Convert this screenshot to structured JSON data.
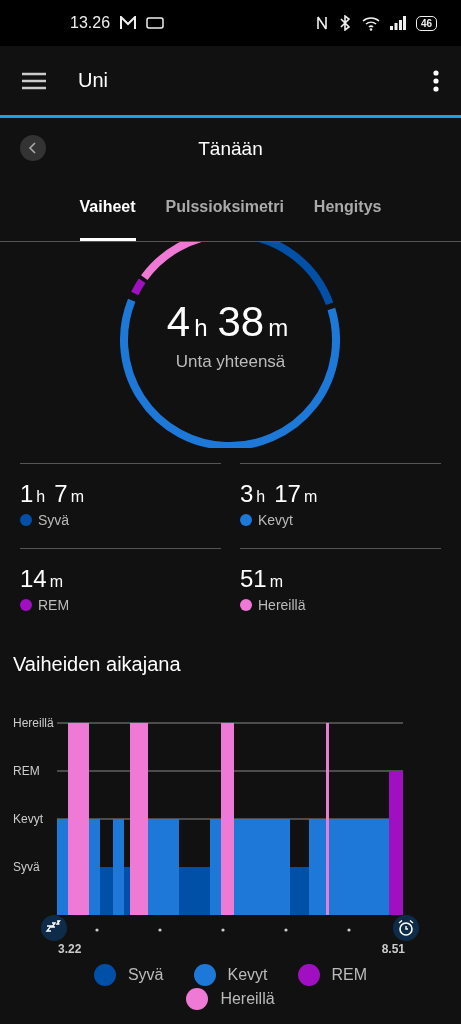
{
  "status_bar": {
    "time": "13.26",
    "battery": "46"
  },
  "app_bar": {
    "title": "Uni"
  },
  "date_nav": {
    "title": "Tänään"
  },
  "tabs": [
    {
      "label": "Vaiheet",
      "selected": true
    },
    {
      "label": "Pulssioksimetri",
      "selected": false
    },
    {
      "label": "Hengitys",
      "selected": false
    }
  ],
  "total": {
    "hours": "4",
    "hours_unit": "h",
    "minutes": "38",
    "minutes_unit": "m",
    "label": "Unta yhteensä"
  },
  "stages": [
    {
      "value": [
        [
          "1",
          "h"
        ],
        [
          "7",
          "m"
        ]
      ],
      "name": "Syvä",
      "color": "#0050a8"
    },
    {
      "value": [
        [
          "3",
          "h"
        ],
        [
          "17",
          "m"
        ]
      ],
      "name": "Kevyt",
      "color": "#1e78d8"
    },
    {
      "value": [
        [
          "14",
          "m"
        ]
      ],
      "name": "REM",
      "color": "#a010c0"
    },
    {
      "value": [
        [
          "51",
          "m"
        ]
      ],
      "name": "Hereillä",
      "color": "#ee7ad6"
    }
  ],
  "timeline": {
    "title": "Vaiheiden aikajana",
    "levels": [
      "Hereillä",
      "REM",
      "Kevyt",
      "Syvä"
    ],
    "start": "3.22",
    "end": "8.51",
    "legend": [
      {
        "name": "Syvä",
        "color": "#0050a8"
      },
      {
        "name": "Kevyt",
        "color": "#1e78d8"
      },
      {
        "name": "REM",
        "color": "#a010c0"
      },
      {
        "name": "Hereillä",
        "color": "#ee7ad6"
      }
    ]
  }
}
